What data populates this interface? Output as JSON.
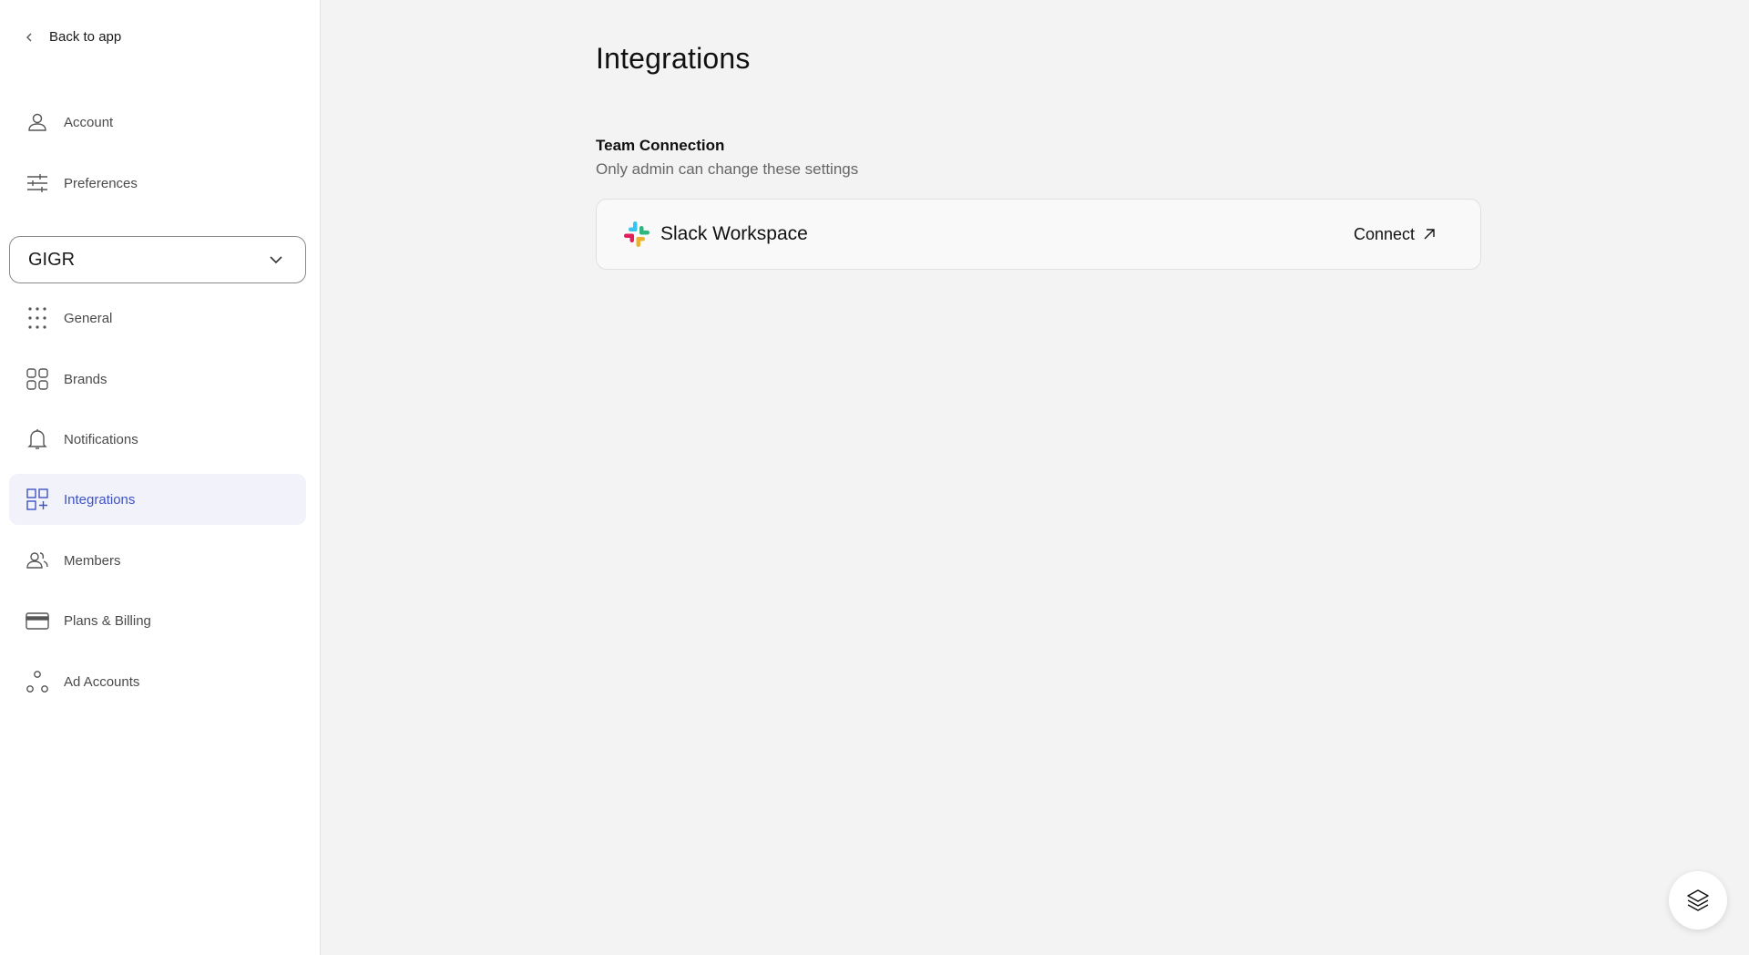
{
  "sidebar": {
    "back_label": "Back to app",
    "top_items": [
      {
        "label": "Account",
        "icon": "user-icon"
      },
      {
        "label": "Preferences",
        "icon": "sliders-icon"
      }
    ],
    "org_select": {
      "value": "GIGR"
    },
    "items": [
      {
        "label": "General",
        "icon": "dots-grid-icon"
      },
      {
        "label": "Brands",
        "icon": "grid-squares-icon"
      },
      {
        "label": "Notifications",
        "icon": "bell-icon"
      },
      {
        "label": "Integrations",
        "icon": "grid-plus-icon",
        "active": true
      },
      {
        "label": "Members",
        "icon": "users-icon"
      },
      {
        "label": "Plans & Billing",
        "icon": "credit-card-icon"
      },
      {
        "label": "Ad Accounts",
        "icon": "nodes-icon"
      }
    ]
  },
  "main": {
    "title": "Integrations",
    "section": {
      "title": "Team Connection",
      "subtitle": "Only admin can change these settings"
    },
    "integration": {
      "name": "Slack Workspace",
      "action_label": "Connect",
      "icon": "slack-logo-icon"
    }
  },
  "colors": {
    "accent": "#3f54c4",
    "active_bg": "#f1f2fa",
    "page_bg": "#f3f3f3"
  },
  "fab": {
    "icon": "layers-icon"
  }
}
